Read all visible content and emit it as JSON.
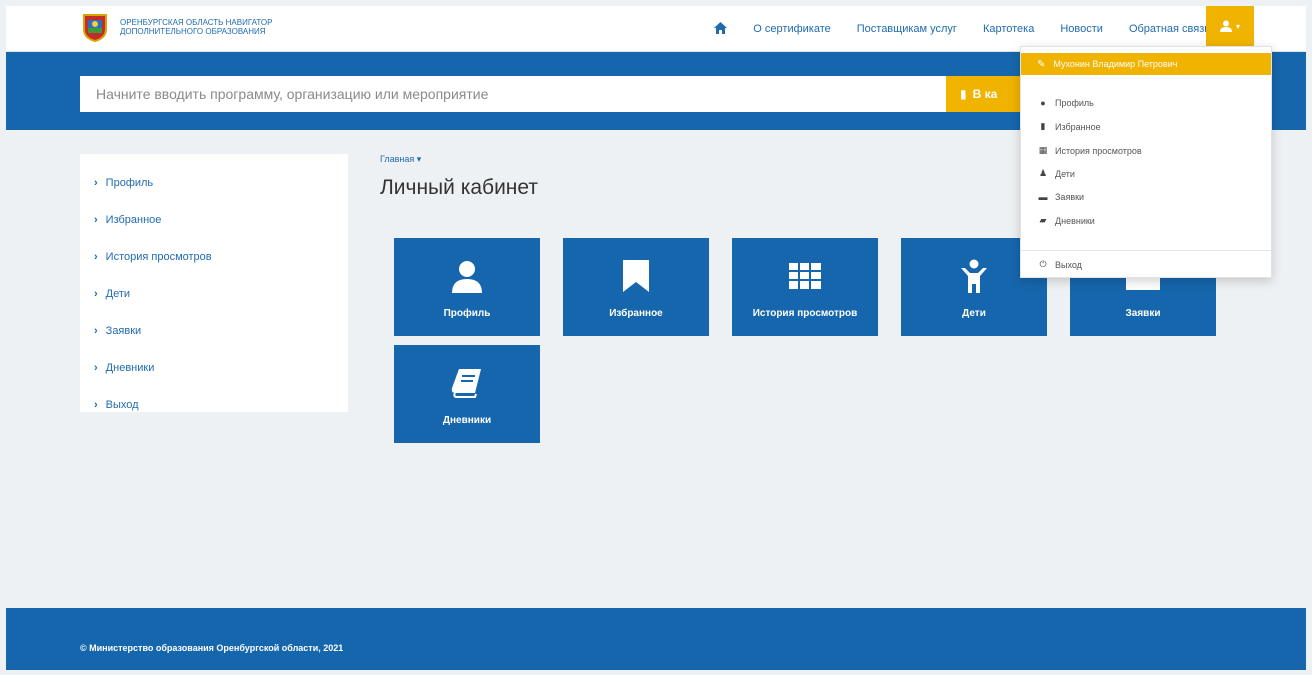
{
  "header": {
    "logo_text": "ОРЕНБУРГСКАЯ ОБЛАСТЬ НАВИГАТОР ДОПОЛНИТЕЛЬНОГО ОБРАЗОВАНИЯ",
    "nav": [
      "О сертификате",
      "Поставщикам услуг",
      "Картотека",
      "Новости",
      "Обратная связь"
    ]
  },
  "search": {
    "placeholder": "Начните вводить программу, организацию или мероприятие",
    "button_label": "В ка"
  },
  "sidebar": {
    "items": [
      "Профиль",
      "Избранное",
      "История просмотров",
      "Дети",
      "Заявки",
      "Дневники",
      "Выход"
    ]
  },
  "main": {
    "breadcrumb": "Главная ▾",
    "title": "Личный кабинет",
    "tiles": [
      "Профиль",
      "Избранное",
      "История просмотров",
      "Дети",
      "Заявки",
      "Дневники"
    ]
  },
  "dropdown": {
    "user_name": "Мухонин Владимир Петрович",
    "items": [
      "Профиль",
      "Избранное",
      "История просмотров",
      "Дети",
      "Заявки",
      "Дневники"
    ],
    "logout": "Выход"
  },
  "footer": {
    "copyright": "© Министерство образования Оренбургской области, 2021"
  },
  "colors": {
    "primary": "#1666ad",
    "accent": "#f0b300",
    "link": "#1f6bb0"
  },
  "icons": {
    "home": "home-icon",
    "user": "user-icon",
    "bookmark": "bookmark-icon",
    "grid": "grid-icon",
    "child": "child-icon",
    "folder": "folder-icon",
    "book": "book-icon",
    "power": "power-icon",
    "edit": "edit-icon"
  }
}
